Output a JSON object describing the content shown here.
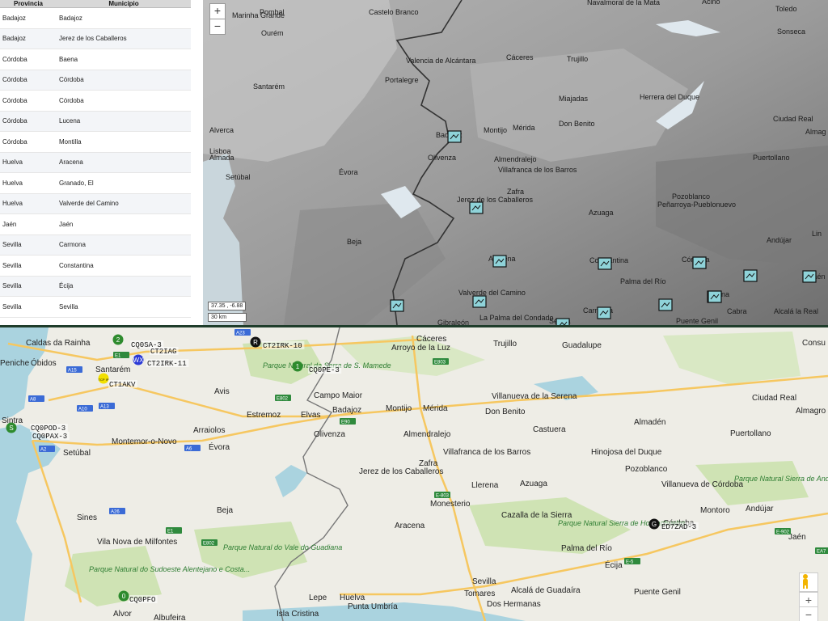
{
  "table": {
    "headers": [
      "Provincia",
      "Municipio"
    ],
    "rows": [
      [
        "Badajoz",
        "Badajoz"
      ],
      [
        "Badajoz",
        "Jerez de los Caballeros"
      ],
      [
        "Córdoba",
        "Baena"
      ],
      [
        "Córdoba",
        "Córdoba"
      ],
      [
        "Córdoba",
        "Córdoba"
      ],
      [
        "Córdoba",
        "Lucena"
      ],
      [
        "Córdoba",
        "Montilla"
      ],
      [
        "Huelva",
        "Aracena"
      ],
      [
        "Huelva",
        "Granado, El"
      ],
      [
        "Huelva",
        "Valverde del Camino"
      ],
      [
        "Jaén",
        "Jaén"
      ],
      [
        "Sevilla",
        "Carmona"
      ],
      [
        "Sevilla",
        "Constantina"
      ],
      [
        "Sevilla",
        "Écija"
      ],
      [
        "Sevilla",
        "Sevilla"
      ]
    ]
  },
  "top_map": {
    "zoom_in": "+",
    "zoom_out": "−",
    "coordinates": "37.35 , -6.88",
    "scale": "30 km",
    "labels": [
      "Pombal",
      "Castelo Branco",
      "Navalmoral de la Mata",
      "Toledo",
      "Marinha Grande",
      "Ourém",
      "Sonseca",
      "Cáceres",
      "Trujillo",
      "Valencia de Alcántara",
      "Portalegre",
      "Santarém",
      "Miajadas",
      "Herrera del Duque",
      "Ciudad Real",
      "Almag",
      "Alverca",
      "Badajoz",
      "Montijo",
      "Mérida",
      "Don Benito",
      "Lisboa",
      "Almada",
      "Olivenza",
      "Almendralejo",
      "Puertollano",
      "Setúbal",
      "Évora",
      "Villafranca de los Barros",
      "Zafra",
      "Jerez de los Caballeros",
      "Pozoblanco",
      "Peñarroya-Pueblonuevo",
      "Azuaga",
      "Beja",
      "Andújar",
      "Aracena",
      "Constantina",
      "Córdoba",
      "Lin",
      "Jaén",
      "Palma del Río",
      "Valverde del Camino",
      "Baena",
      "Carmona",
      "Cabra",
      "Alcalá la Real",
      "Gibraleón",
      "La Palma del Condado",
      "Sevilla",
      "Puente Genil",
      "Acino"
    ]
  },
  "bottom_map": {
    "zoom_in": "+",
    "zoom_out": "−",
    "cities": [
      "Caldas da Rainha",
      "Peniche",
      "Óbidos",
      "Santarém",
      "Cáceres",
      "Trujillo",
      "Guadalupe",
      "Arroyo de la Luz",
      "Avis",
      "Campo Maior",
      "Elvas",
      "Estremoz",
      "Badajoz",
      "Montijo",
      "Mérida",
      "Villanueva de la Serena",
      "Don Benito",
      "Ciudad Real",
      "Almagro",
      "Sintra",
      "Arraiolos",
      "Montemor-o-Novo",
      "Évora",
      "Olivenza",
      "Almendralejo",
      "Castuera",
      "Almadén",
      "Puertollano",
      "Setúbal",
      "Hinojosa del Duque",
      "Villafranca de los Barros",
      "Zafra",
      "Jerez de los Caballeros",
      "Azuaga",
      "Llerena",
      "Pozoblanco",
      "Villanueva de Córdoba",
      "Beja",
      "Monesterio",
      "Cazalla de la Sierra",
      "Montoro",
      "Andújar",
      "Sines",
      "Aracena",
      "Córdoba",
      "Jaén",
      "Vila Nova de Milfontes",
      "Palma del Río",
      "Écija",
      "Sevilla",
      "Alcalá de Guadaíra",
      "Dos Hermanas",
      "Puente Genil",
      "Lepe",
      "Huelva",
      "Punta Umbría",
      "Tomares",
      "Isla Cristina",
      "Albufeira",
      "Alvor",
      "Consu"
    ],
    "parks": [
      "Parque Natural da Serra de S. Mamede",
      "Parque Natural do Vale do Guadiana",
      "Parque Natural do Sudoeste Alentejano e Costa...",
      "Parque Natural Sierra de Hornachuelos",
      "Parque Natural Sierra de Andújar"
    ],
    "roads": [
      "A23",
      "E1",
      "A15",
      "E90",
      "E803",
      "E802",
      "A8",
      "A10",
      "A13",
      "A6",
      "A2",
      "E-803",
      "A26",
      "E802",
      "E1",
      "E-5",
      "E-902",
      "EA7"
    ],
    "stations": [
      "CQ0SA-3",
      "CT2IAG",
      "CT2IRK-11",
      "CT2IRK-10",
      "CQ0PE-3",
      "CT1AKV",
      "CQ0POD-3",
      "CQ0PAX-3",
      "CQ0PFO",
      "ED7ZAD-3"
    ],
    "station_badges": [
      "2",
      "1",
      "R",
      "WX",
      "TCP IP",
      "S",
      "G",
      "0"
    ]
  }
}
